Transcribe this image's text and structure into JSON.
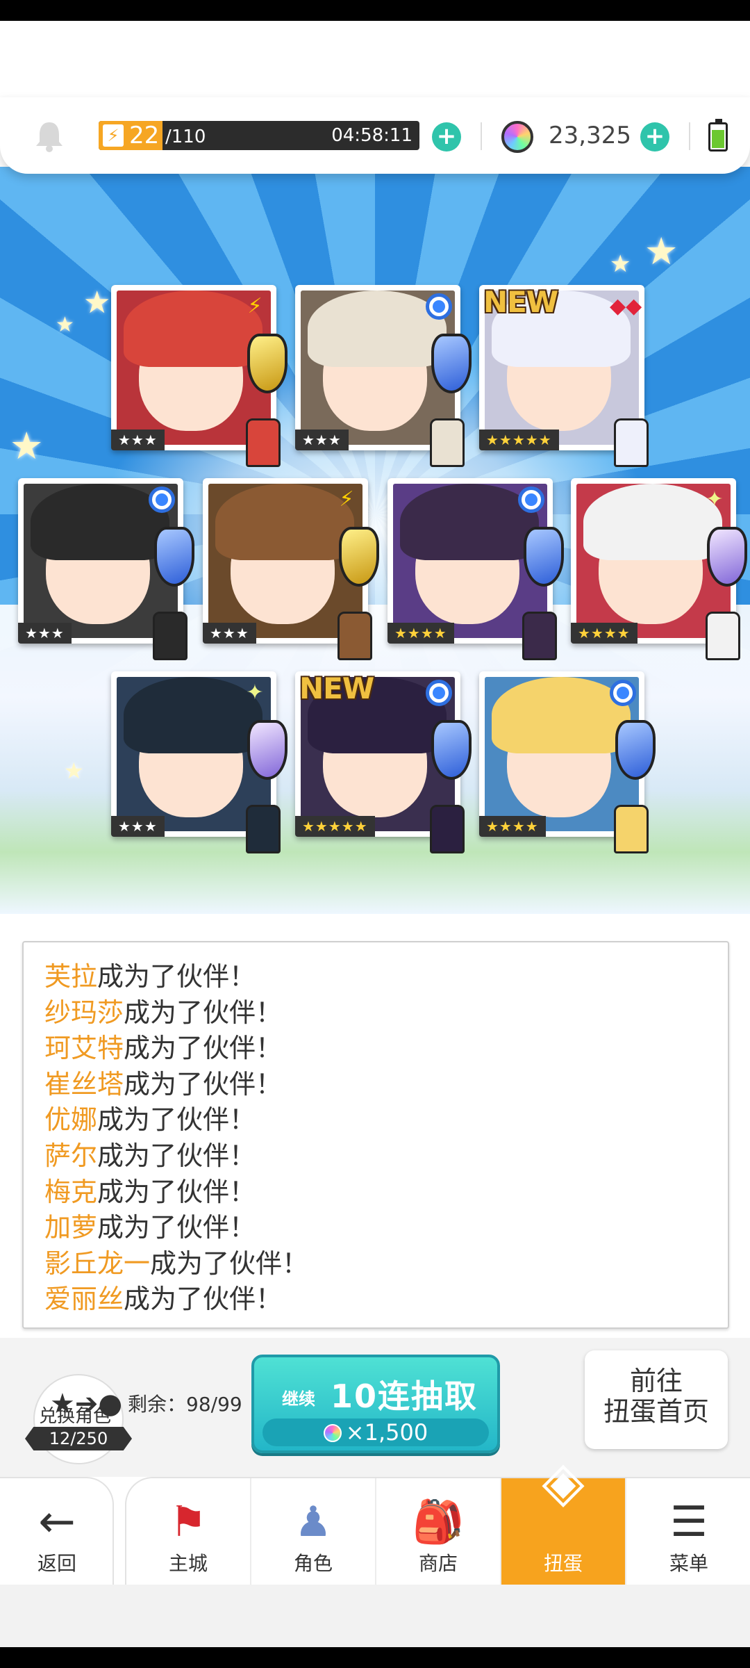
{
  "topbar": {
    "stamina_current": "22",
    "stamina_max": "/110",
    "stamina_fraction": 0.2,
    "stamina_timer": "04:58:11",
    "gem_count": "23,325",
    "bolt_glyph": "⚡"
  },
  "cards": [
    {
      "element": "thunder",
      "stars": "★★★",
      "new": false,
      "hair": "#d8453b",
      "bg": "#b9343a"
    },
    {
      "element": "water",
      "stars": "★★★",
      "new": false,
      "hair": "#e9e1d2",
      "bg": "#7a6a5a"
    },
    {
      "element": "fire",
      "stars": "★★★★★",
      "new": true,
      "hair": "#eef0fb",
      "bg": "#c8c8dc"
    },
    {
      "element": "water",
      "stars": "★★★",
      "new": false,
      "hair": "#2a2a2a",
      "bg": "#3c3c3c"
    },
    {
      "element": "thunder",
      "stars": "★★★",
      "new": false,
      "hair": "#8b5a33",
      "bg": "#6b4a2b"
    },
    {
      "element": "water",
      "stars": "★★★★",
      "new": false,
      "hair": "#3b2a4a",
      "bg": "#5a3d86"
    },
    {
      "element": "light",
      "stars": "★★★★",
      "new": false,
      "hair": "#f2f2f2",
      "bg": "#c43a4a"
    },
    {
      "element": "light",
      "stars": "★★★",
      "new": false,
      "hair": "#1f2c3a",
      "bg": "#2d4059"
    },
    {
      "element": "water",
      "stars": "★★★★★",
      "new": true,
      "hair": "#2b2040",
      "bg": "#3a2f4f"
    },
    {
      "element": "water",
      "stars": "★★★★",
      "new": false,
      "hair": "#f5d36b",
      "bg": "#4c8ac2"
    }
  ],
  "new_label": "NEW",
  "log": [
    {
      "name": "芙拉",
      "text": "成为了伙伴！"
    },
    {
      "name": "纱玛莎",
      "text": "成为了伙伴！"
    },
    {
      "name": "珂艾特",
      "text": "成为了伙伴！"
    },
    {
      "name": "崔丝塔",
      "text": "成为了伙伴！"
    },
    {
      "name": "优娜",
      "text": "成为了伙伴！"
    },
    {
      "name": "萨尔",
      "text": "成为了伙伴！"
    },
    {
      "name": "梅克",
      "text": "成为了伙伴！"
    },
    {
      "name": "加萝",
      "text": "成为了伙伴！"
    },
    {
      "name": "影丘龙一",
      "text": "成为了伙伴！"
    },
    {
      "name": "爱丽丝",
      "text": "成为了伙伴！"
    }
  ],
  "action": {
    "exchange_label": "兑换角色",
    "exchange_count": "12/250",
    "remaining": "剩余：98/99",
    "continue_label": "继续",
    "pull_label": "10连抽取",
    "pull_cost": "×1,500",
    "goto_line1": "前往",
    "goto_line2": "扭蛋首页"
  },
  "nav": {
    "back": "返回",
    "items": [
      "主城",
      "角色",
      "商店",
      "扭蛋",
      "菜单"
    ],
    "active": "扭蛋"
  },
  "colors": {
    "accent_orange": "#f7a31e",
    "teal": "#2fc4ab",
    "name_orange": "#f09a22"
  }
}
